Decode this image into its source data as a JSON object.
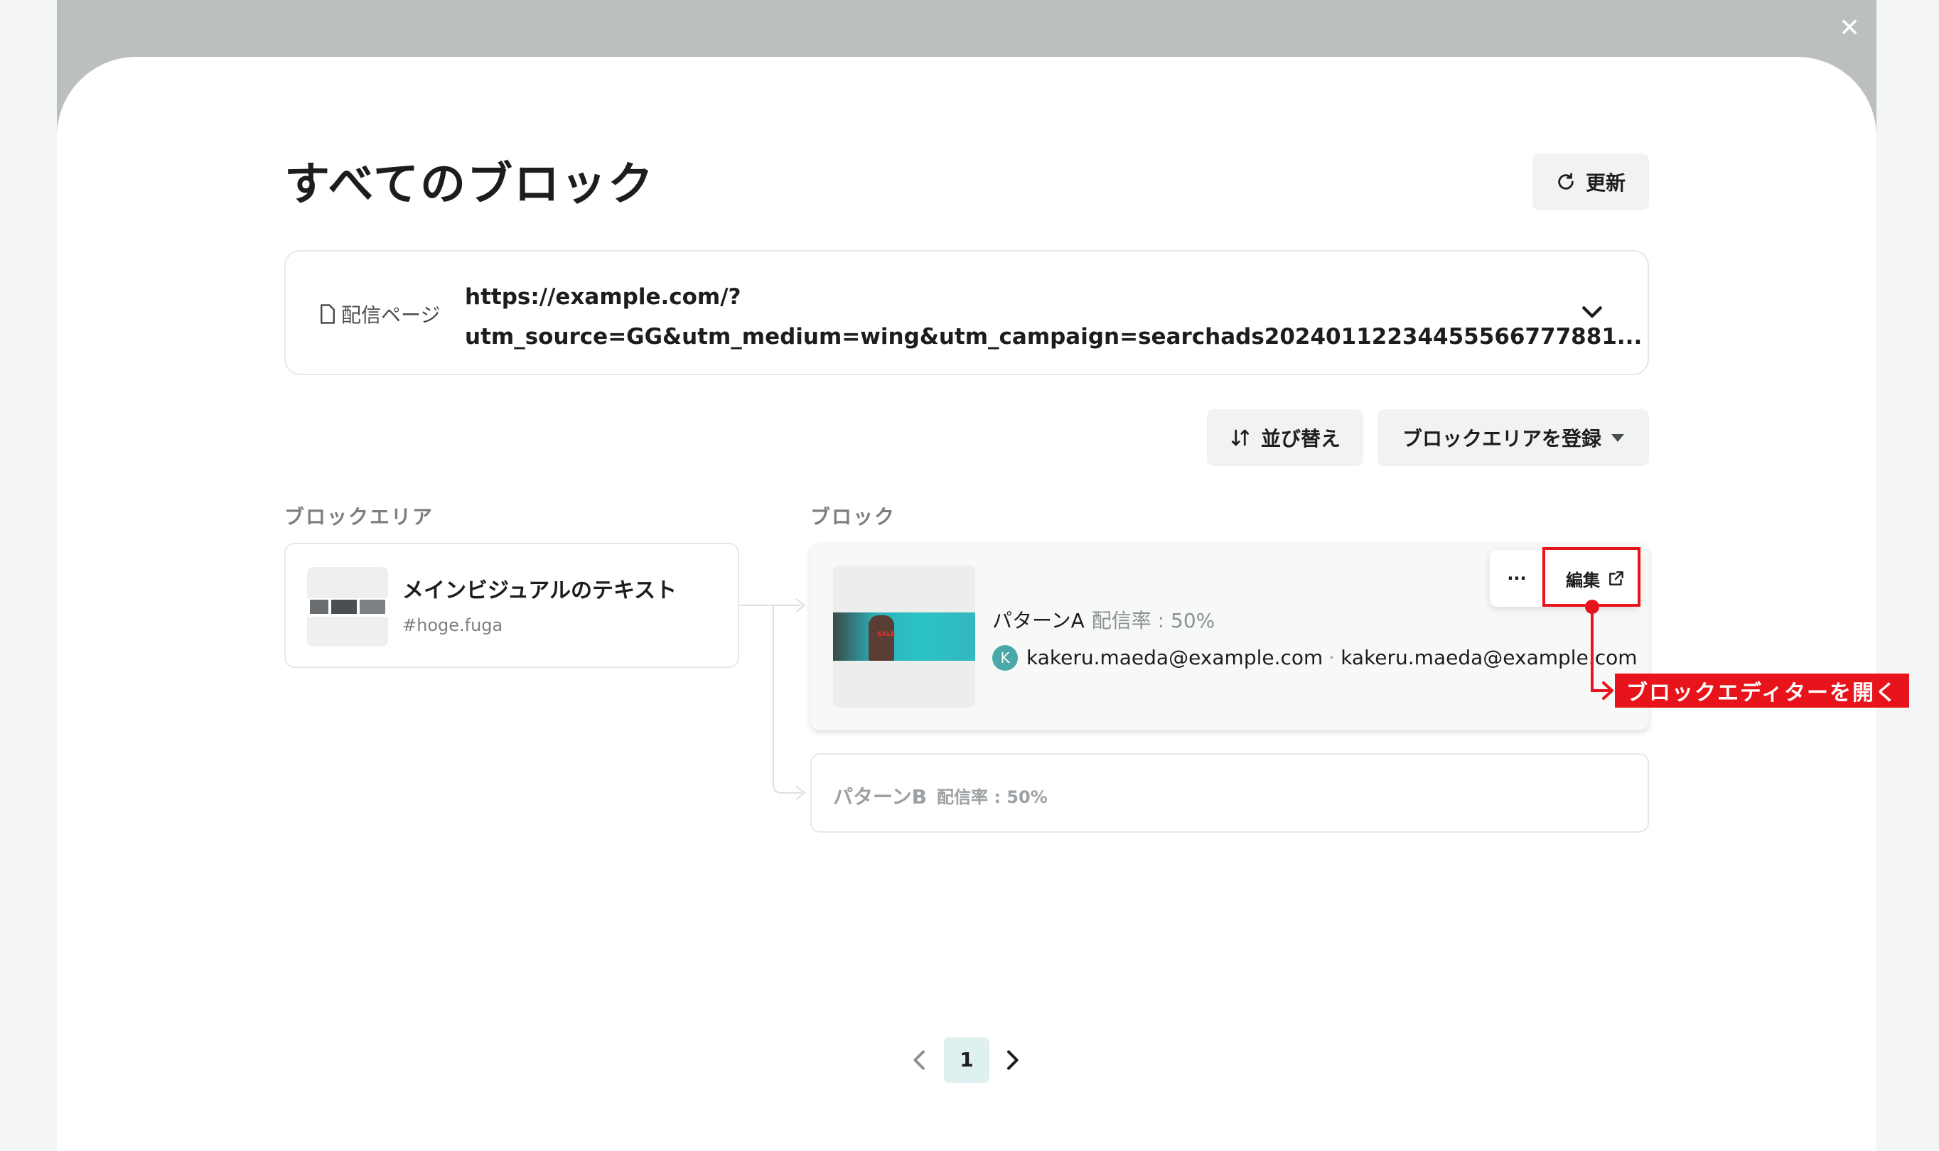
{
  "modal": {
    "title": "すべてのブロック",
    "close_icon": "close-icon",
    "refresh_label": "更新"
  },
  "page_selector": {
    "label": "配信ページ",
    "url_line1": "https://example.com/?",
    "url_line2": "utm_source=GG&utm_medium=wing&utm_campaign=searchads2024011223445556677788​1..."
  },
  "toolbar": {
    "sort_label": "並び替え",
    "register_label": "ブロックエリアを登録"
  },
  "sections": {
    "area_label": "ブロックエリア",
    "block_label": "ブロック"
  },
  "block_area": {
    "name": "メインビジュアルのテキスト",
    "selector": "#hoge.fuga"
  },
  "blocks": [
    {
      "name": "パターンA",
      "rate": "配信率 : 50%",
      "banner_text": "SALE",
      "avatar_initial": "K",
      "user1": "kakeru.maeda@example.com",
      "separator": "·",
      "user2": "kakeru.maeda@example.com",
      "more_label": "···",
      "edit_label": "編集"
    },
    {
      "name": "パターンB",
      "rate": "配信率 : 50%"
    }
  ],
  "annotation": {
    "callout_text": "ブロックエディターを開く",
    "color": "#e8141b"
  },
  "pagination": {
    "current_page": "1"
  }
}
